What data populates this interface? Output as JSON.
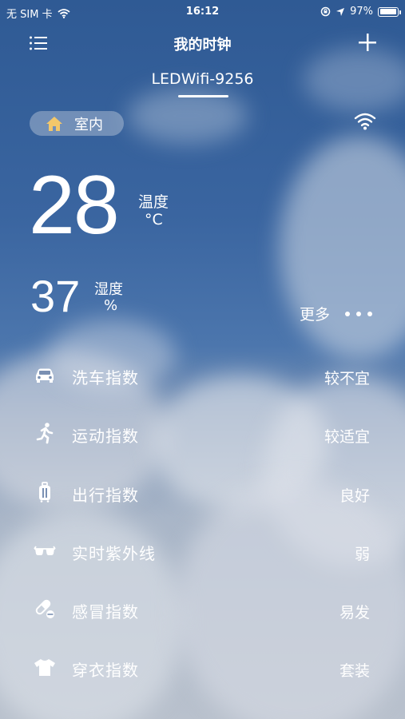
{
  "status_bar": {
    "carrier": "无 SIM 卡",
    "time": "16:12",
    "battery": "97%",
    "battery_level": 0.97
  },
  "nav": {
    "title": "我的时钟",
    "menu_icon": "list-menu-icon",
    "add_icon": "plus-icon"
  },
  "device": {
    "name": "LEDWifi-9256"
  },
  "room": {
    "label": "室内",
    "icon": "home-icon"
  },
  "temperature": {
    "value": "28",
    "label": "温度",
    "unit": "°C"
  },
  "humidity": {
    "value": "37",
    "label": "湿度",
    "unit": "%"
  },
  "more": {
    "label": "更多"
  },
  "indices": [
    {
      "name": "洗车指数",
      "value": "较不宜",
      "icon": "car-icon"
    },
    {
      "name": "运动指数",
      "value": "较适宜",
      "icon": "running-icon"
    },
    {
      "name": "出行指数",
      "value": "良好",
      "icon": "luggage-icon"
    },
    {
      "name": "实时紫外线",
      "value": "弱",
      "icon": "sunglasses-icon"
    },
    {
      "name": "感冒指数",
      "value": "易发",
      "icon": "pill-icon"
    },
    {
      "name": "穿衣指数",
      "value": "套装",
      "icon": "tshirt-icon"
    }
  ],
  "colors": {
    "sky_top": "#2f5a94",
    "sky_bottom": "#b9c1cd",
    "pill_background": "#c8d2e1",
    "home_icon": "#f2c76b"
  }
}
